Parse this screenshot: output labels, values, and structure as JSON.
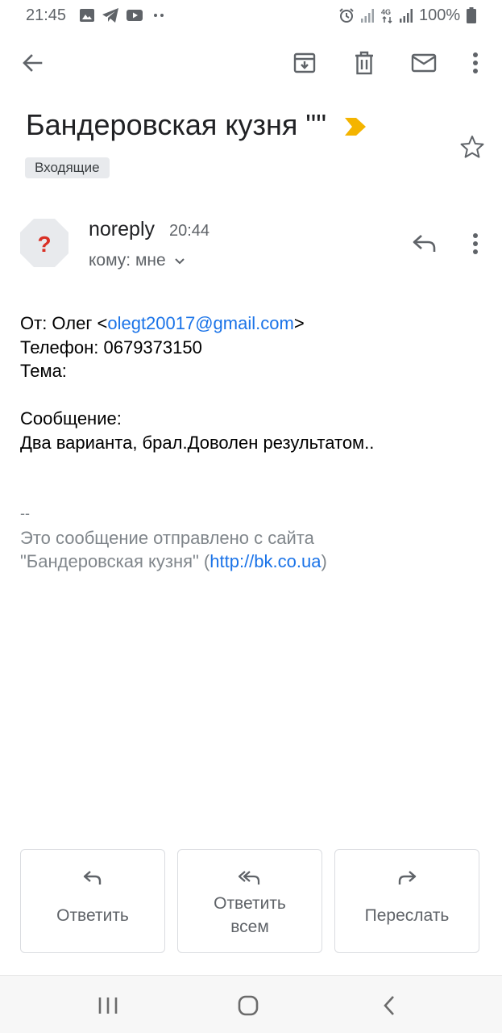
{
  "status_bar": {
    "time": "21:45",
    "battery_text": "100%",
    "icons": [
      "image-icon",
      "telegram-icon",
      "youtube-icon",
      "more-dots-icon",
      "alarm-icon",
      "signal-icon",
      "4g-icon",
      "signal-icon",
      "battery-icon"
    ]
  },
  "toolbar": {
    "icons": [
      "back-arrow-icon",
      "archive-icon",
      "delete-icon",
      "mark-unread-icon",
      "more-vert-icon"
    ]
  },
  "email": {
    "subject": "Бандеровская кузня \"\"",
    "label": "Входящие",
    "sender": "noreply",
    "time": "20:44",
    "recipient": "кому: мне",
    "avatar_glyph": "?"
  },
  "body": {
    "from_prefix": "От: Олег <",
    "from_email": "olegt20017@gmail.com",
    "from_suffix": ">",
    "phone": "Телефон: 0679373150",
    "topic": "Тема:",
    "message_label": "Сообщение:",
    "message_text": "Два варианта, брал.Доволен результатом..",
    "sig_dash": "--",
    "sig_line1": "Это сообщение отправлено с сайта",
    "sig_line2_prefix": "\"Бандеровская кузня\" (",
    "sig_link": "http://bk.co.ua",
    "sig_line2_suffix": ")"
  },
  "actions": {
    "reply": "Ответить",
    "reply_all_line1": "Ответить",
    "reply_all_line2": "всем",
    "forward": "Переслать"
  },
  "colors": {
    "accent_link": "#1a73e8",
    "importance": "#f4b400",
    "avatar_question": "#d93025"
  }
}
